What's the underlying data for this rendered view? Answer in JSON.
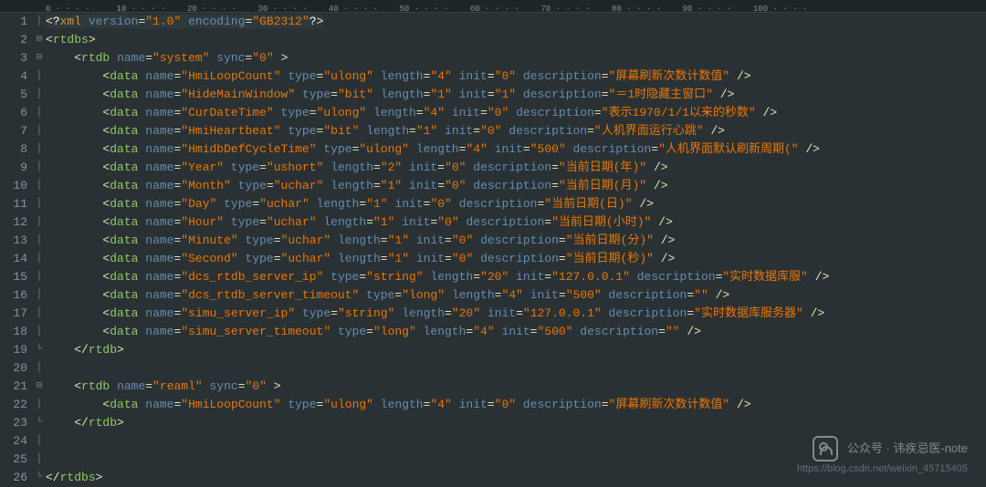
{
  "ruler": [
    0,
    10,
    20,
    30,
    40,
    50,
    60,
    70,
    80,
    90,
    100
  ],
  "lines": [
    {
      "n": 1,
      "fold": "",
      "indent": 0,
      "raw": "xmldecl"
    },
    {
      "n": 2,
      "fold": "⊟",
      "indent": 0,
      "tag": "rtdbs",
      "open": true
    },
    {
      "n": 3,
      "fold": "⊟",
      "indent": 1,
      "tag": "rtdb",
      "open": true,
      "attrs": [
        [
          "name",
          "system"
        ],
        [
          "sync",
          "0"
        ]
      ],
      "trail": " >"
    },
    {
      "n": 4,
      "fold": "",
      "indent": 2,
      "tag": "data",
      "self": true,
      "attrs": [
        [
          "name",
          "HmiLoopCount"
        ],
        [
          "type",
          "ulong"
        ],
        [
          "length",
          "4"
        ],
        [
          "init",
          "0"
        ],
        [
          "description",
          "屏幕刷新次数计数值"
        ]
      ]
    },
    {
      "n": 5,
      "fold": "",
      "indent": 2,
      "tag": "data",
      "self": true,
      "attrs": [
        [
          "name",
          "HideMainWindow"
        ],
        [
          "type",
          "bit"
        ],
        [
          "length",
          "1"
        ],
        [
          "init",
          "1"
        ],
        [
          "description",
          "＝1时隐藏主窗口"
        ]
      ]
    },
    {
      "n": 6,
      "fold": "",
      "indent": 2,
      "tag": "data",
      "self": true,
      "attrs": [
        [
          "name",
          "CurDateTime"
        ],
        [
          "type",
          "ulong"
        ],
        [
          "length",
          "4"
        ],
        [
          "init",
          "0"
        ],
        [
          "description",
          "表示1970/1/1以来的秒数"
        ]
      ]
    },
    {
      "n": 7,
      "fold": "",
      "indent": 2,
      "tag": "data",
      "self": true,
      "attrs": [
        [
          "name",
          "HmiHeartbeat"
        ],
        [
          "type",
          "bit"
        ],
        [
          "length",
          "1"
        ],
        [
          "init",
          "0"
        ],
        [
          "description",
          "人机界面运行心跳"
        ]
      ]
    },
    {
      "n": 8,
      "fold": "",
      "indent": 2,
      "tag": "data",
      "self": true,
      "attrs": [
        [
          "name",
          "HmidbDefCycleTime"
        ],
        [
          "type",
          "ulong"
        ],
        [
          "length",
          "4"
        ],
        [
          "init",
          "500"
        ],
        [
          "description",
          "人机界面默认刷新周期("
        ]
      ]
    },
    {
      "n": 9,
      "fold": "",
      "indent": 2,
      "tag": "data",
      "self": true,
      "attrs": [
        [
          "name",
          "Year"
        ],
        [
          "type",
          "ushort"
        ],
        [
          "length",
          "2"
        ],
        [
          "init",
          "0"
        ],
        [
          "description",
          "当前日期(年)"
        ]
      ]
    },
    {
      "n": 10,
      "fold": "",
      "indent": 2,
      "tag": "data",
      "self": true,
      "attrs": [
        [
          "name",
          "Month"
        ],
        [
          "type",
          "uchar"
        ],
        [
          "length",
          "1"
        ],
        [
          "init",
          "0"
        ],
        [
          "description",
          "当前日期(月)"
        ]
      ]
    },
    {
      "n": 11,
      "fold": "",
      "indent": 2,
      "tag": "data",
      "self": true,
      "attrs": [
        [
          "name",
          "Day"
        ],
        [
          "type",
          "uchar"
        ],
        [
          "length",
          "1"
        ],
        [
          "init",
          "0"
        ],
        [
          "description",
          "当前日期(日)"
        ]
      ]
    },
    {
      "n": 12,
      "fold": "",
      "indent": 2,
      "tag": "data",
      "self": true,
      "attrs": [
        [
          "name",
          "Hour"
        ],
        [
          "type",
          "uchar"
        ],
        [
          "length",
          "1"
        ],
        [
          "init",
          "0"
        ],
        [
          "description",
          "当前日期(小时)"
        ]
      ]
    },
    {
      "n": 13,
      "fold": "",
      "indent": 2,
      "tag": "data",
      "self": true,
      "attrs": [
        [
          "name",
          "Minute"
        ],
        [
          "type",
          "uchar"
        ],
        [
          "length",
          "1"
        ],
        [
          "init",
          "0"
        ],
        [
          "description",
          "当前日期(分)"
        ]
      ]
    },
    {
      "n": 14,
      "fold": "",
      "indent": 2,
      "tag": "data",
      "self": true,
      "attrs": [
        [
          "name",
          "Second"
        ],
        [
          "type",
          "uchar"
        ],
        [
          "length",
          "1"
        ],
        [
          "init",
          "0"
        ],
        [
          "description",
          "当前日期(秒)"
        ]
      ]
    },
    {
      "n": 15,
      "fold": "",
      "indent": 2,
      "tag": "data",
      "self": true,
      "attrs": [
        [
          "name",
          "dcs_rtdb_server_ip"
        ],
        [
          "type",
          "string"
        ],
        [
          "length",
          "20"
        ],
        [
          "init",
          "127.0.0.1"
        ],
        [
          "description",
          "实时数据库服"
        ]
      ]
    },
    {
      "n": 16,
      "fold": "",
      "indent": 2,
      "tag": "data",
      "self": true,
      "attrs": [
        [
          "name",
          "dcs_rtdb_server_timeout"
        ],
        [
          "type",
          "long"
        ],
        [
          "length",
          "4"
        ],
        [
          "init",
          "500"
        ],
        [
          "description",
          ""
        ]
      ]
    },
    {
      "n": 17,
      "fold": "",
      "indent": 2,
      "tag": "data",
      "self": true,
      "attrs": [
        [
          "name",
          "simu_server_ip"
        ],
        [
          "type",
          "string"
        ],
        [
          "length",
          "20"
        ],
        [
          "init",
          "127.0.0.1"
        ],
        [
          "description",
          "实时数据库服务器"
        ]
      ]
    },
    {
      "n": 18,
      "fold": "",
      "indent": 2,
      "tag": "data",
      "self": true,
      "attrs": [
        [
          "name",
          "simu_server_timeout"
        ],
        [
          "type",
          "long"
        ],
        [
          "length",
          "4"
        ],
        [
          "init",
          "500"
        ],
        [
          "description",
          ""
        ]
      ]
    },
    {
      "n": 19,
      "fold": "-",
      "indent": 1,
      "tag": "rtdb",
      "close": true
    },
    {
      "n": 20,
      "fold": "",
      "indent": 0,
      "blank": true
    },
    {
      "n": 21,
      "fold": "⊟",
      "indent": 1,
      "tag": "rtdb",
      "open": true,
      "attrs": [
        [
          "name",
          "reaml"
        ],
        [
          "sync",
          "0"
        ]
      ],
      "trail": " >"
    },
    {
      "n": 22,
      "fold": "",
      "indent": 2,
      "tag": "data",
      "self": true,
      "attrs": [
        [
          "name",
          "HmiLoopCount"
        ],
        [
          "type",
          "ulong"
        ],
        [
          "length",
          "4"
        ],
        [
          "init",
          "0"
        ],
        [
          "description",
          "屏幕刷新次数计数值"
        ]
      ]
    },
    {
      "n": 23,
      "fold": "-",
      "indent": 1,
      "tag": "rtdb",
      "close": true
    },
    {
      "n": 24,
      "fold": "",
      "indent": 0,
      "blank": true
    },
    {
      "n": 25,
      "fold": "",
      "indent": 0,
      "blank": true
    },
    {
      "n": 26,
      "fold": "-",
      "indent": 0,
      "tag": "rtdbs",
      "close": true
    }
  ],
  "watermark": {
    "text": "公众号 · 讳疾忌医-note",
    "url": "https://blog.csdn.net/weixin_45715405"
  },
  "xmldecl": {
    "version": "1.0",
    "encoding": "GB2312"
  }
}
